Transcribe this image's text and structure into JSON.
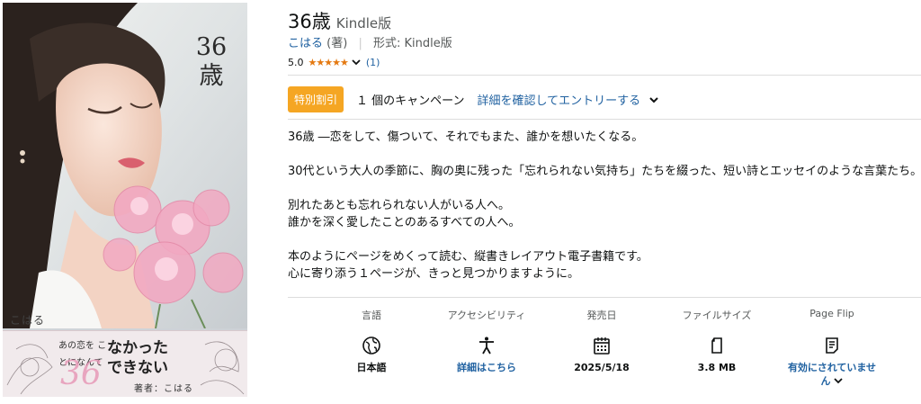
{
  "cover": {
    "title_vertical": "36\n歳",
    "author": "こはる",
    "band_small": "あの恋を ことになんて",
    "band_big_1": "なかった",
    "band_big_2": "できない",
    "band_number": "36",
    "band_byline": "著者：こはる"
  },
  "product": {
    "title": "36歳",
    "binding": "Kindle版",
    "author": "こはる",
    "author_role": "(著)",
    "format_label": "形式:",
    "format_value": "Kindle版",
    "rating_value": "5.0",
    "stars": "★★★★★",
    "rating_count": "(1)"
  },
  "deal": {
    "badge": "特別割引",
    "text": "１ 個のキャンペーン",
    "link": "詳細を確認してエントリーする"
  },
  "description": [
    "36歳 ―恋をして、傷ついて、それでもまた、誰かを想いたくなる。",
    "30代という大人の季節に、胸の奥に残った「忘れられない気持ち」たちを綴った、短い詩とエッセイのような言葉たち。",
    "別れたあとも忘れられない人がいる人へ。\n誰かを深く愛したことのあるすべての人へ。",
    "本のようにページをめくって読む、縦書きレイアウト電子書籍です。\n心に寄り添う１ページが、きっと見つかりますように。"
  ],
  "attributes": [
    {
      "label": "言語",
      "icon": "globe-icon",
      "value": "日本語"
    },
    {
      "label": "アクセシビリティ",
      "icon": "accessibility-icon",
      "value": "詳細はこちら"
    },
    {
      "label": "発売日",
      "icon": "calendar-icon",
      "value": "2025/5/18"
    },
    {
      "label": "ファイルサイズ",
      "icon": "file-icon",
      "value": "3.8 MB"
    },
    {
      "label": "Page Flip",
      "icon": "page-flip-icon",
      "value": "有効にされていません"
    }
  ],
  "colors": {
    "link": "#2162a1",
    "badge": "#f5a623",
    "star": "#e47911"
  }
}
